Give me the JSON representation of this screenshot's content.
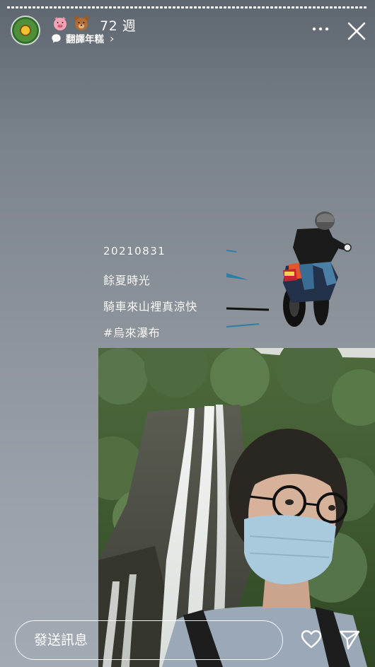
{
  "story": {
    "progress_fraction": 0.55,
    "background_top": "#5e6670",
    "background_bottom": "#a3aab3"
  },
  "header": {
    "avatar": "sunflower-avatar",
    "emojis": [
      "pig-face-icon",
      "bear-face-icon"
    ],
    "weeks_label": "72 週",
    "translate_label": "翻譯年糕",
    "translate_chevron": "›",
    "more_icon": "more-dots-icon",
    "close_icon": "close-icon"
  },
  "caption": {
    "date": "20210831",
    "line1": "餘夏時光",
    "line2": "騎車來山裡真涼快",
    "hashtag": "#烏來瀑布"
  },
  "bottom_bar": {
    "message_placeholder": "發送訊息",
    "like_icon": "heart-icon",
    "send_icon": "send-icon"
  }
}
